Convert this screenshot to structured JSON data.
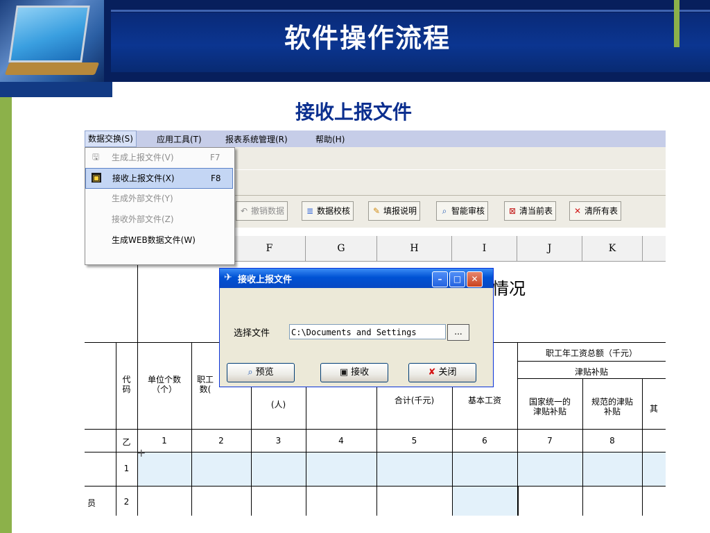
{
  "slide": {
    "title": "软件操作流程",
    "subtitle": "接收上报文件"
  },
  "menubar": {
    "items": [
      "数据交换(S)",
      "应用工具(T)",
      "报表系统管理(R)",
      "帮助(H)"
    ]
  },
  "dropdown": {
    "items": [
      {
        "label": "生成上报文件(V)",
        "shortcut": "F7",
        "enabled": false,
        "icon": "save-disk-icon"
      },
      {
        "label": "接收上报文件(X)",
        "shortcut": "F8",
        "enabled": true,
        "selected": true,
        "icon": "floppy-disk-icon"
      },
      {
        "label": "生成外部文件(Y)",
        "shortcut": "",
        "enabled": false
      },
      {
        "label": "接收外部文件(Z)",
        "shortcut": "",
        "enabled": false
      },
      {
        "label": "生成WEB数据文件(W)",
        "shortcut": "",
        "enabled": true
      }
    ]
  },
  "toolbar": {
    "buttons": [
      {
        "label": "撤销数据",
        "icon": "undo-icon",
        "enabled": false
      },
      {
        "label": "数据校核",
        "icon": "check-data-icon",
        "enabled": true
      },
      {
        "label": "填报说明",
        "icon": "pencil-icon",
        "enabled": true
      },
      {
        "label": "智能审核",
        "icon": "magnifier-icon",
        "enabled": true
      },
      {
        "label": "清当前表",
        "icon": "clear-table-icon",
        "enabled": true
      },
      {
        "label": "清所有表",
        "icon": "clear-all-icon",
        "enabled": true
      }
    ]
  },
  "grid": {
    "columns": [
      "F",
      "G",
      "H",
      "I",
      "J",
      "K"
    ],
    "title_partial": "情况",
    "header_top": "职工年工资总额（千元）",
    "header_sub": "津贴补贴",
    "headers": {
      "code": "代\n码",
      "unit_count": "单位个数\n（个）",
      "staff_partial": "职工\n数(",
      "col3_partial": "(人)",
      "total_partial": "合计(千元)",
      "base_wage": "基本工资",
      "national_allowance": "国家统一的\n津贴补贴",
      "standard_allowance": "规范的津贴\n补贴",
      "cut_off": "其"
    },
    "index_row": [
      "乙",
      "1",
      "2",
      "3",
      "4",
      "5",
      "6",
      "7",
      "8"
    ],
    "rows": [
      {
        "code": "1",
        "label": ""
      },
      {
        "code": "2",
        "label": "员"
      }
    ]
  },
  "dialog": {
    "title": "接收上报文件",
    "file_label": "选择文件",
    "file_value": "C:\\Documents and Settings",
    "browse_label": "...",
    "buttons": {
      "preview": "预览",
      "receive": "接收",
      "close": "关闭"
    }
  },
  "colors": {
    "slide_navy": "#071f5c",
    "accent_green": "#8cb14a",
    "subtitle_blue": "#0b2f8f",
    "xp_title_blue": "#0052d4",
    "highlight_row": "#e3f1fa"
  }
}
